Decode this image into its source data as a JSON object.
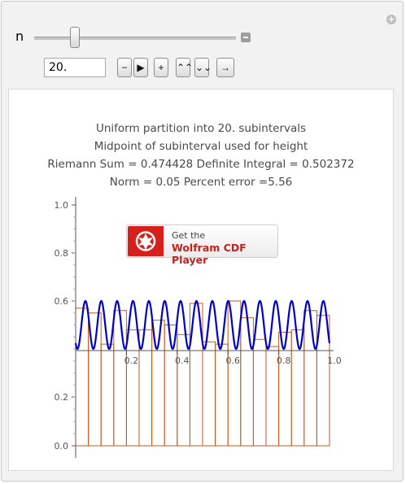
{
  "controls": {
    "slider_label": "n",
    "n_value": "20.",
    "buttons": {
      "step_back": "−",
      "play": "▶",
      "step_forward": "+",
      "faster": "⌃⌃",
      "slower": "⌄⌄",
      "direction": "→"
    },
    "slider_fraction": 0.18
  },
  "plot": {
    "lines": [
      "Uniform partition into 20. subintervals",
      "Midpoint of subinterval used for height",
      "Riemann Sum = 0.474428    Definite Integral = 0.502372",
      "Norm = 0.05    Percent error =5.56"
    ],
    "badge": {
      "get": "Get the",
      "name": "Wolfram CDF Player"
    }
  },
  "chart_data": {
    "type": "bar",
    "title": "",
    "x_ticks": [
      "0.2",
      "0.4",
      "0.6",
      "0.8",
      "1.0"
    ],
    "y_ticks": [
      "0.0",
      "0.2",
      "0.6",
      "0.8",
      "1.0"
    ],
    "xlim": [
      0,
      1
    ],
    "ylim": [
      0,
      1.0
    ],
    "bar_edges": [
      0,
      0.05,
      0.1,
      0.15,
      0.2,
      0.25,
      0.3,
      0.35,
      0.4,
      0.45,
      0.5,
      0.55,
      0.6,
      0.65,
      0.7,
      0.75,
      0.8,
      0.85,
      0.9,
      0.95,
      1.0
    ],
    "bar_heights": [
      0.57,
      0.55,
      0.42,
      0.56,
      0.48,
      0.48,
      0.52,
      0.5,
      0.46,
      0.59,
      0.43,
      0.42,
      0.6,
      0.53,
      0.44,
      0.41,
      0.47,
      0.48,
      0.56,
      0.54
    ],
    "curve": {
      "mid": 0.5,
      "amp": 0.1,
      "cycles": 16
    },
    "colors": {
      "bars": "#c85a1e",
      "curve": "#0000cc",
      "axis": "#555555"
    }
  }
}
